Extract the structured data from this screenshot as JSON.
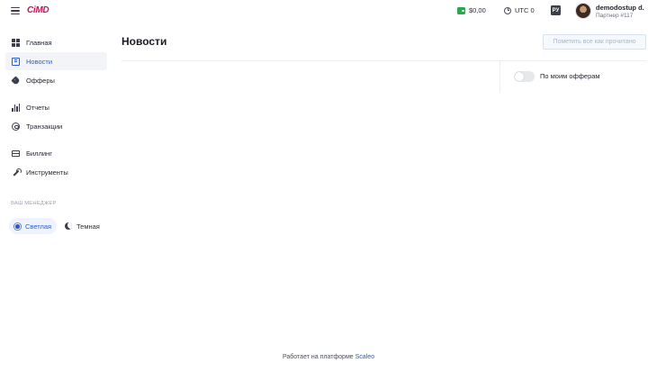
{
  "header": {
    "logo": "CiMD",
    "balance": "$0,00",
    "timezone": "UTC 0",
    "language": "РУ",
    "user_name": "demodostup d.",
    "user_sub": "Партнер #117"
  },
  "sidebar": {
    "items": [
      {
        "label": "Главная",
        "icon": "dashboard-icon"
      },
      {
        "label": "Новости",
        "icon": "news-icon",
        "active": true
      },
      {
        "label": "Офферы",
        "icon": "tag-icon"
      },
      {
        "label": "Отчеты",
        "icon": "bar-chart-icon"
      },
      {
        "label": "Транзакции",
        "icon": "fingerprint-icon"
      },
      {
        "label": "Биллинг",
        "icon": "credit-card-icon"
      },
      {
        "label": "Инструменты",
        "icon": "wrench-icon"
      }
    ],
    "manager_label": "ВАШ МЕНЕДЖЕР",
    "theme_light": "Светлая",
    "theme_dark": "Темная"
  },
  "main": {
    "title": "Новости",
    "mark_all_button": "Пометить все как прочитано",
    "filter_toggle_label": "По моим офферам",
    "filter_toggle_on": false
  },
  "footer": {
    "text": "Работает на платформе",
    "link": "Scaleo"
  },
  "colors": {
    "accent": "#2a5ad8",
    "logo": "#c2185b",
    "wallet": "#2ea44f"
  }
}
